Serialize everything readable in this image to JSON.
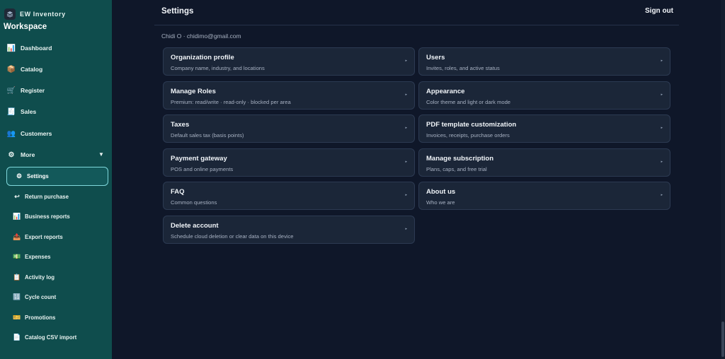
{
  "app": {
    "brand": "EW Inventory",
    "workspace": "Workspace",
    "logo_icon": "layers-icon"
  },
  "sidebar": {
    "items": [
      {
        "label": "Dashboard",
        "icon": "chart-icon",
        "glyph": "📊"
      },
      {
        "label": "Catalog",
        "icon": "box-icon",
        "glyph": "📦"
      },
      {
        "label": "Register",
        "icon": "cart-icon",
        "glyph": "🛒"
      },
      {
        "label": "Sales",
        "icon": "receipt-icon",
        "glyph": "🧾"
      },
      {
        "label": "Customers",
        "icon": "users-icon",
        "glyph": "👥"
      },
      {
        "label": "More",
        "icon": "gear-icon",
        "glyph": "⚙"
      }
    ],
    "more_caret": "▼",
    "sub_items": [
      {
        "label": "Settings",
        "icon": "gear-icon",
        "glyph": "⚙"
      },
      {
        "label": "Return purchase",
        "icon": "return-icon",
        "glyph": "↩"
      },
      {
        "label": "Business reports",
        "icon": "bar-chart-icon",
        "glyph": "📊"
      },
      {
        "label": "Export reports",
        "icon": "export-icon",
        "glyph": "📤"
      },
      {
        "label": "Expenses",
        "icon": "money-icon",
        "glyph": "💵"
      },
      {
        "label": "Activity log",
        "icon": "clipboard-icon",
        "glyph": "📋"
      },
      {
        "label": "Cycle count",
        "icon": "counter-icon",
        "glyph": "🔢"
      },
      {
        "label": "Promotions",
        "icon": "ticket-icon",
        "glyph": "🎫"
      },
      {
        "label": "Catalog CSV import",
        "icon": "file-icon",
        "glyph": "📄"
      }
    ]
  },
  "header": {
    "title": "Settings",
    "sign_out": "Sign out"
  },
  "user": {
    "line": "Chidi O · chidimo@gmail.com"
  },
  "cards": [
    {
      "title": "Organization profile",
      "subtitle": "Company name, industry, and locations"
    },
    {
      "title": "Users",
      "subtitle": "Invites, roles, and active status"
    },
    {
      "title": "Manage Roles",
      "subtitle": "Premium: read/write · read-only · blocked per area"
    },
    {
      "title": "Appearance",
      "subtitle": "Color theme and light or dark mode"
    },
    {
      "title": "Taxes",
      "subtitle": "Default sales tax (basis points)"
    },
    {
      "title": "PDF template customization",
      "subtitle": "Invoices, receipts, purchase orders"
    },
    {
      "title": "Payment gateway",
      "subtitle": "POS and online payments"
    },
    {
      "title": "Manage subscription",
      "subtitle": "Plans, caps, and free trial"
    },
    {
      "title": "FAQ",
      "subtitle": "Common questions"
    },
    {
      "title": "About us",
      "subtitle": "Who we are"
    },
    {
      "title": "Delete account",
      "subtitle": "Schedule cloud deletion or clear data on this device"
    }
  ],
  "chevron": "▸",
  "colors": {
    "sidebar_bg": "#0f4d4d",
    "main_bg": "#0f1729",
    "card_bg": "#1b2638",
    "active_border": "#7fd8dc"
  }
}
